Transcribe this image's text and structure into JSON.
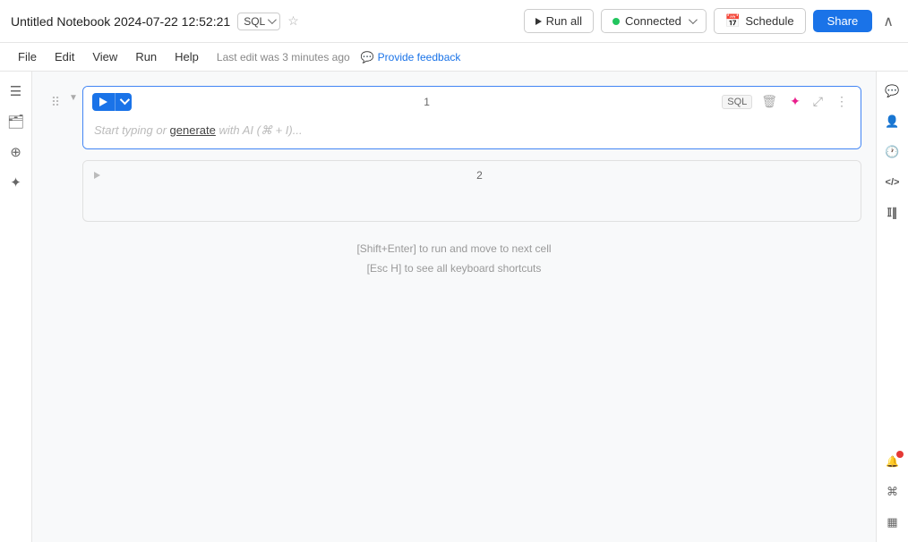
{
  "header": {
    "title": "Untitled Notebook 2024-07-22 12:52:21",
    "sql_label": "SQL",
    "run_all_label": "Run all",
    "connected_label": "Connected",
    "schedule_label": "Schedule",
    "share_label": "Share",
    "last_edit": "Last edit was 3 minutes ago",
    "feedback_label": "Provide feedback",
    "collapse_label": "∧"
  },
  "menu": {
    "items": [
      "File",
      "Edit",
      "View",
      "Run",
      "Help"
    ]
  },
  "cells": [
    {
      "number": "1",
      "sql_badge": "SQL",
      "placeholder": "Start typing or generate with AI (⌘ + I)...",
      "active": true
    },
    {
      "number": "2",
      "active": false
    }
  ],
  "hints": {
    "line1": "[Shift+Enter] to run and move to next cell",
    "line2": "[Esc H] to see all keyboard shortcuts"
  },
  "sidebar_left": {
    "icons": [
      {
        "name": "document-icon",
        "glyph": "☰"
      },
      {
        "name": "folder-icon",
        "glyph": "📁"
      },
      {
        "name": "database-icon",
        "glyph": "⊕"
      },
      {
        "name": "sparkle-icon",
        "glyph": "✦"
      }
    ]
  },
  "sidebar_right": {
    "icons": [
      {
        "name": "comment-icon",
        "glyph": "💬"
      },
      {
        "name": "person-icon",
        "glyph": "👤"
      },
      {
        "name": "history-icon",
        "glyph": "🕐"
      },
      {
        "name": "code-icon",
        "glyph": "</>"
      },
      {
        "name": "library-icon",
        "glyph": "𝕀∥"
      }
    ],
    "bottom_icons": [
      {
        "name": "keyboard-icon",
        "glyph": "⌘"
      },
      {
        "name": "layout-icon",
        "glyph": "▦"
      }
    ],
    "notification_icon": {
      "name": "notification-icon",
      "glyph": "🔔"
    }
  }
}
